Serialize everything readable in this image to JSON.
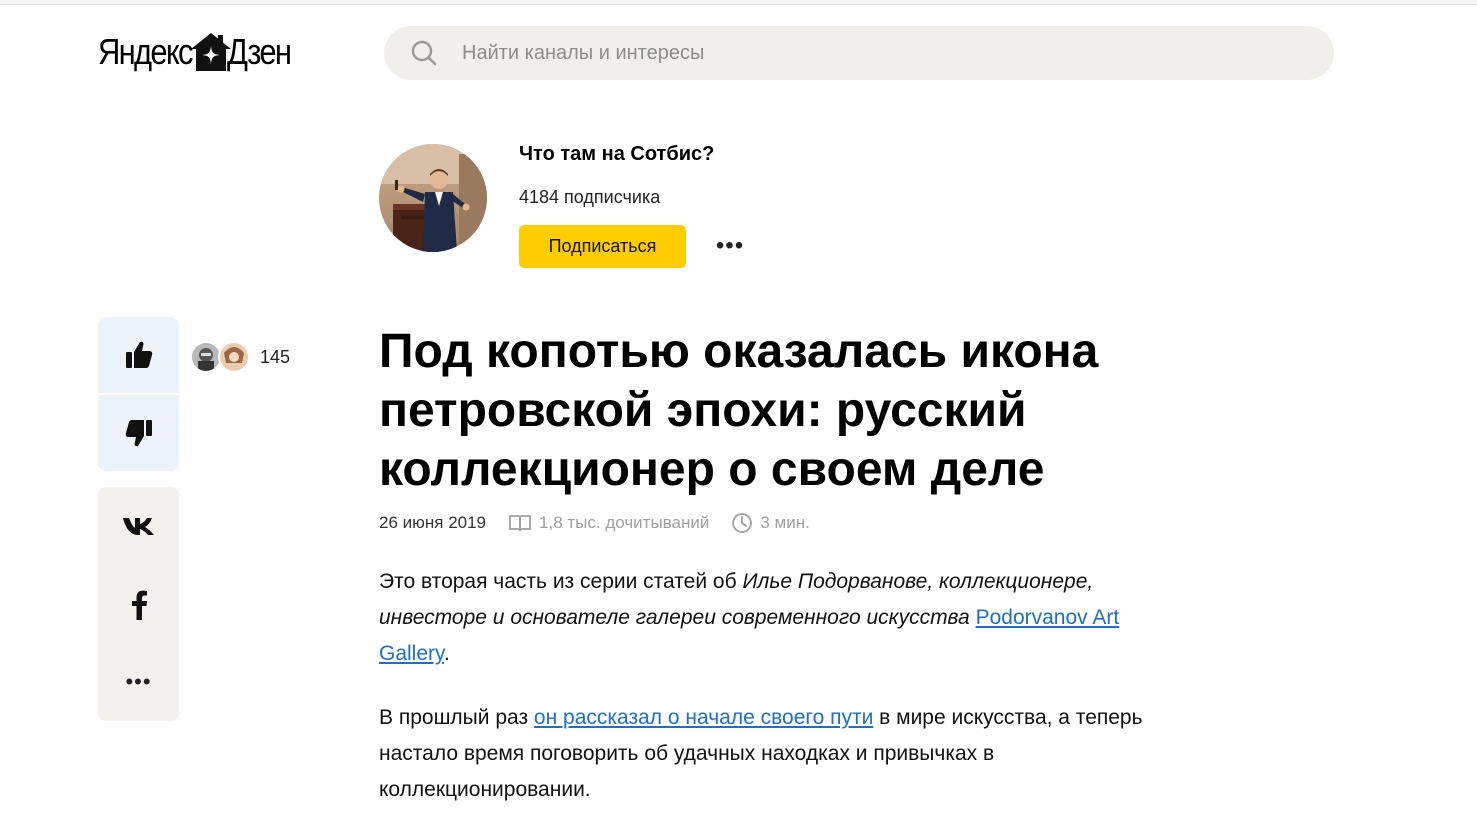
{
  "header": {
    "logo_part1": "Яндекс",
    "logo_part2": "Дзен",
    "search_placeholder": "Найти каналы и интересы"
  },
  "channel": {
    "name": "Что там на Сотбис?",
    "subscribers": "4184 подписчика",
    "subscribe_label": "Подписаться",
    "more_label": "•••"
  },
  "reactions": {
    "likes_count": "145"
  },
  "share": {
    "more_label": "•••"
  },
  "article": {
    "title": "Под копотью оказалась икона петровской эпохи: русский коллекционер о своем деле",
    "date": "26 июня 2019",
    "reads": "1,8 тыс. дочитываний",
    "read_time": "3 мин.",
    "p1_text1": "Это вторая часть из серии статей об ",
    "p1_italic": "Илье Подорванове, коллекционере, инвесторе и основателе галереи современного искусства ",
    "p1_link": "Podorvanov Art Gallery",
    "p1_end": ".",
    "p2_text1": "В прошлый раз ",
    "p2_link": "он рассказал о начале своего пути",
    "p2_text2": " в мире искусства, а теперь настало время поговорить об удачных находках и привычках в коллекционировании."
  },
  "colors": {
    "accent_yellow": "#ffcc00",
    "link_blue": "#1e6ecb",
    "search_bg": "#f0efeb",
    "reactions_bg": "#eef3fb",
    "share_bg": "#f2f1ee"
  }
}
